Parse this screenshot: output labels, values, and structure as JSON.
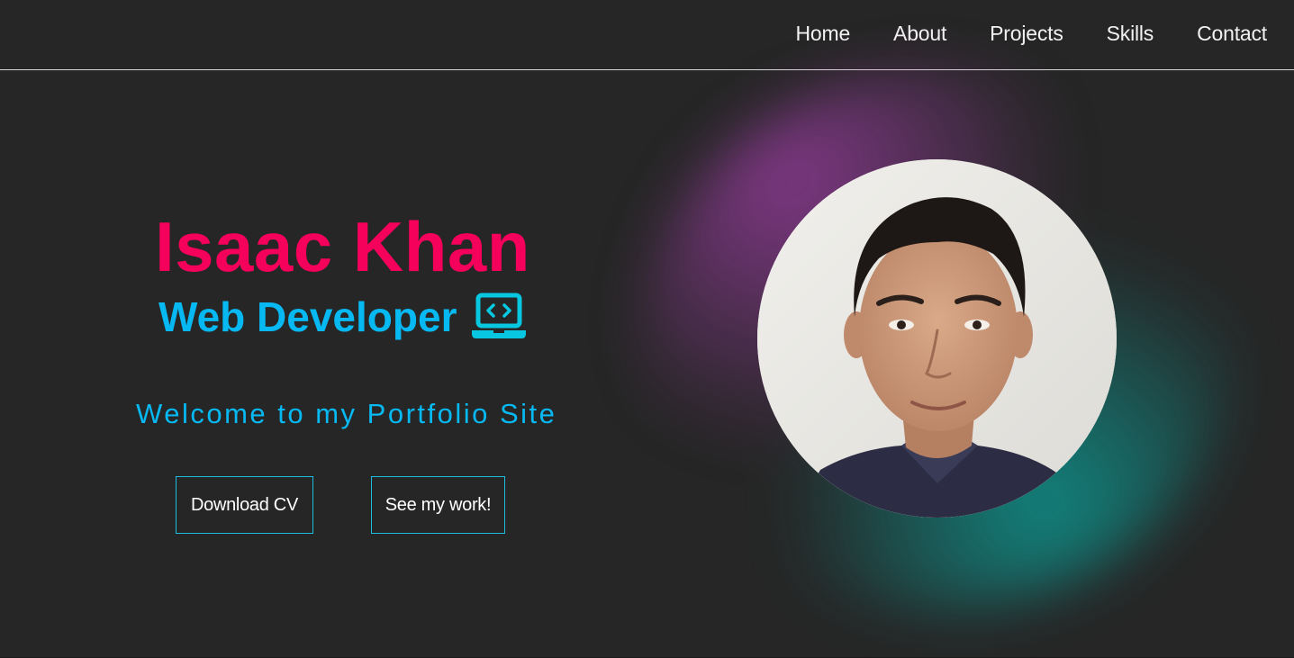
{
  "nav": {
    "items": [
      {
        "label": "Home"
      },
      {
        "label": "About"
      },
      {
        "label": "Projects"
      },
      {
        "label": "Skills"
      },
      {
        "label": "Contact"
      }
    ]
  },
  "hero": {
    "name": "Isaac Khan",
    "role": "Web Developer",
    "role_icon": "laptop-code-icon",
    "welcome": "Welcome to my Portfolio Site",
    "buttons": {
      "download_cv": "Download CV",
      "see_work": "See my work!"
    }
  },
  "colors": {
    "background": "#262626",
    "name": "#f5005a",
    "accent": "#07b9f3",
    "button_border": "#1dbde0",
    "glow_left": "#c846d2",
    "glow_right": "#00d2c8"
  }
}
